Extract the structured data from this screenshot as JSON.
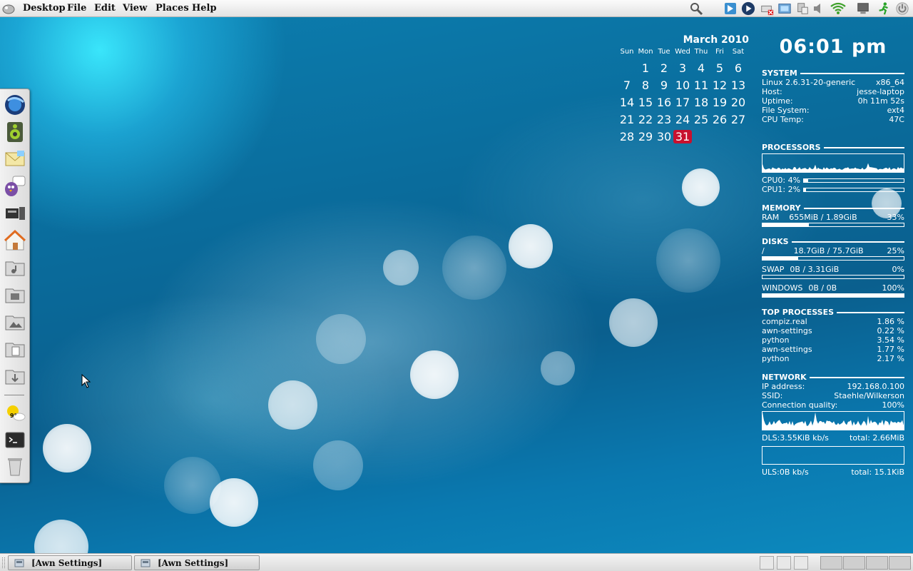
{
  "top_panel": {
    "menus": [
      "Desktop",
      "File",
      "Edit",
      "View",
      "Places",
      "Help"
    ],
    "menu_access_keys": [
      "",
      "F",
      "E",
      "V",
      "P",
      "H"
    ],
    "tray_icons": [
      "search-icon",
      "awn-settings-icon",
      "media-player-icon",
      "printer-error-icon",
      "screenshot-icon",
      "network-manager-icon",
      "volume-icon",
      "wifi-icon",
      "display-icon",
      "running-man-icon",
      "power-icon"
    ]
  },
  "dock": {
    "icons": [
      "web-browser-icon",
      "music-player-icon",
      "mail-icon",
      "pidgin-icon",
      "disk-utility-icon",
      "home-folder-icon",
      "music-folder-icon",
      "videos-folder-icon",
      "pictures-folder-icon",
      "documents-folder-icon",
      "downloads-folder-icon",
      "weather-applet-icon",
      "terminal-icon",
      "trash-icon"
    ],
    "weather_temp": "9°"
  },
  "calendar": {
    "title": "March 2010",
    "weekdays": [
      "Sun",
      "Mon",
      "Tue",
      "Wed",
      "Thu",
      "Fri",
      "Sat"
    ],
    "weeks": [
      [
        "",
        "1",
        "2",
        "3",
        "4",
        "5",
        "6"
      ],
      [
        "7",
        "8",
        "9",
        "10",
        "11",
        "12",
        "13"
      ],
      [
        "14",
        "15",
        "16",
        "17",
        "18",
        "19",
        "20"
      ],
      [
        "21",
        "22",
        "23",
        "24",
        "25",
        "26",
        "27"
      ],
      [
        "28",
        "29",
        "30",
        "31",
        "",
        "",
        ""
      ]
    ],
    "today": "31",
    "today_color": "#c8102e"
  },
  "conky": {
    "clock": "06:01 pm",
    "system": {
      "heading": "SYSTEM",
      "rows": [
        {
          "k": "Linux 2.6.31-20-generic",
          "v": "x86_64"
        },
        {
          "k": "Host:",
          "v": "jesse-laptop"
        },
        {
          "k": "Uptime:",
          "v": "0h 11m 52s"
        },
        {
          "k": "File System:",
          "v": "ext4"
        },
        {
          "k": "CPU Temp:",
          "v": "47C"
        }
      ]
    },
    "processors": {
      "heading": "PROCESSORS",
      "cpus": [
        {
          "label": "CPU0: 4%",
          "percent": 4
        },
        {
          "label": "CPU1: 2%",
          "percent": 2
        }
      ]
    },
    "memory": {
      "heading": "MEMORY",
      "label": "RAM",
      "value": "655MiB / 1.89GiB",
      "percent_text": "33%",
      "percent": 33
    },
    "disks": {
      "heading": "DISKS",
      "items": [
        {
          "label": "/",
          "value": "18.7GiB / 75.7GiB",
          "percent_text": "25%",
          "percent": 25
        },
        {
          "label": "SWAP",
          "value": "0B  / 3.31GiB",
          "percent_text": "0%",
          "percent": 0
        },
        {
          "label": "WINDOWS",
          "value": "0B  / 0B",
          "percent_text": "100%",
          "percent": 100
        }
      ]
    },
    "top_processes": {
      "heading": "TOP PROCESSES",
      "items": [
        {
          "name": "compiz.real",
          "cpu": "1.86 %"
        },
        {
          "name": "awn-settings",
          "cpu": "0.22 %"
        },
        {
          "name": "python",
          "cpu": "3.54 %"
        },
        {
          "name": "awn-settings",
          "cpu": "1.77 %"
        },
        {
          "name": "python",
          "cpu": "2.17 %"
        }
      ]
    },
    "network": {
      "heading": "NETWORK",
      "rows": [
        {
          "k": "IP address:",
          "v": "192.168.0.100"
        },
        {
          "k": "SSID:",
          "v": "Staehle/Wilkerson"
        },
        {
          "k": "Connection quality:",
          "v": "100%"
        }
      ],
      "download": {
        "rate": "DLS:3.55KiB kb/s",
        "total": "total: 2.66MiB"
      },
      "upload": {
        "rate": "ULS:0B   kb/s",
        "total": "total: 15.1KiB"
      }
    }
  },
  "taskbar": {
    "tasks": [
      "[Awn Settings]",
      "[Awn Settings]"
    ],
    "workspaces": 4
  }
}
